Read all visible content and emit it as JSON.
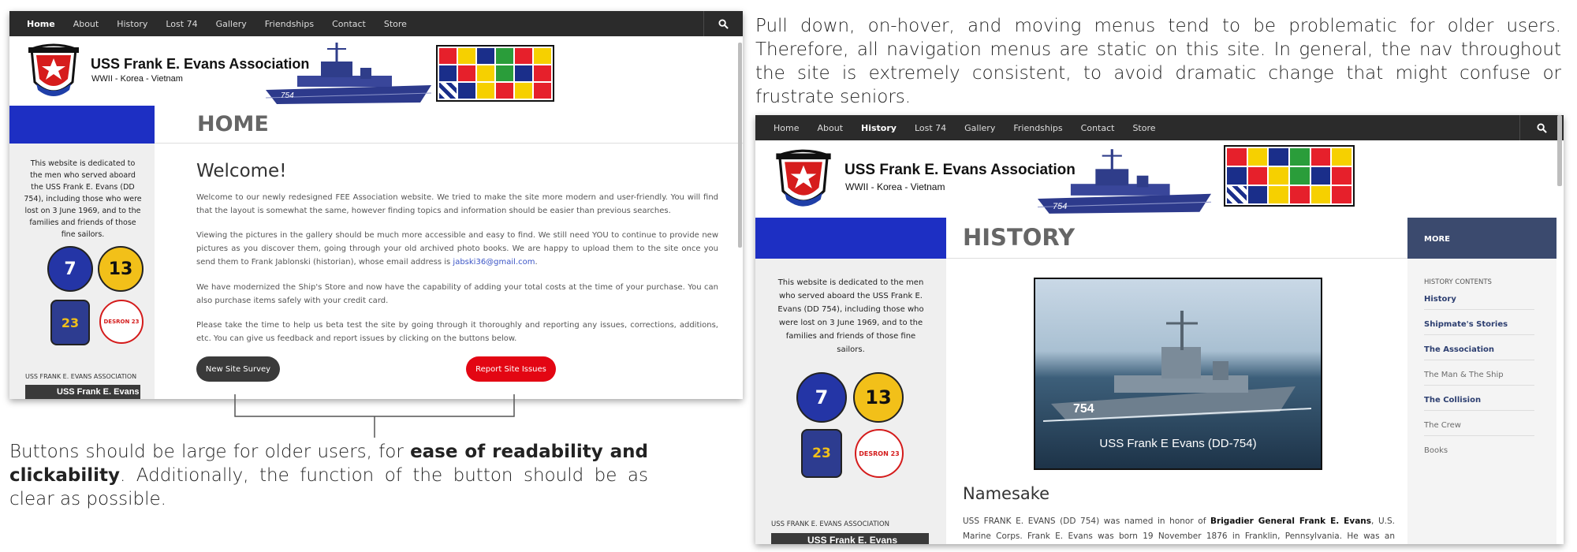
{
  "left_site": {
    "nav": [
      "Home",
      "About",
      "History",
      "Lost 74",
      "Gallery",
      "Friendships",
      "Contact",
      "Store"
    ],
    "active_nav": "Home",
    "site_name": "USS Frank E. Evans Association",
    "site_sub": "WWII - Korea - Vietnam",
    "ship_number": "754",
    "page_title": "HOME",
    "sidebar_text": "This website is dedicated to the men who served aboard the USS Frank E. Evans (DD 754), including those who were lost on 3 June 1969, and to the families and friends of those fine sailors.",
    "badges": [
      "7",
      "13",
      "23",
      "DESRON 23"
    ],
    "assoc_label": "USS FRANK E. EVANS ASSOCIATION",
    "assoc_box": "USS Frank E. Evans",
    "welcome": "Welcome!",
    "paragraphs": [
      "Welcome to our newly redesigned FEE Association website. We tried to make the site more modern and user-friendly. You will find that the layout is somewhat the same, however finding topics and information should be easier than previous searches.",
      "Viewing the pictures in the gallery should be much more accessible and easy to find. We still need YOU to continue to provide new pictures as you discover them, going through your old archived photo books. We are happy to upload them to the site once you send them to Frank Jablonski (historian), whose email address is",
      "We have modernized the Ship's Store and now have the capability of adding your total costs at the time of your purchase. You can also purchase items safely with your credit card.",
      "Please take the time to help us beta test the site by going through it thoroughly and reporting any issues, corrections, additions, etc. You can give us feedback and report issues by clicking on the buttons below."
    ],
    "email": "jabski36@gmail.com",
    "button_survey": "New Site Survey",
    "button_report": "Report Site Issues"
  },
  "right_site": {
    "nav": [
      "Home",
      "About",
      "History",
      "Lost 74",
      "Gallery",
      "Friendships",
      "Contact",
      "Store"
    ],
    "active_nav": "History",
    "site_name": "USS Frank E. Evans Association",
    "site_sub": "WWII - Korea - Vietnam",
    "ship_number": "754",
    "page_title": "HISTORY",
    "sidebar_text": "This website is dedicated to the men who served aboard the USS Frank E. Evans (DD 754), including those who were lost on 3 June 1969, and to the families and friends of those fine sailors.",
    "badges": [
      "7",
      "13",
      "23",
      "DESRON 23"
    ],
    "assoc_label": "USS FRANK E. EVANS ASSOCIATION",
    "assoc_box": "USS Frank E. Evans",
    "photo_caption": "USS Frank E Evans (DD-754)",
    "photo_hull": "754",
    "namesake": "Namesake",
    "namesake_text_a": "USS FRANK E. EVANS (DD 754) was named in honor of ",
    "namesake_bold": "Brigadier General Frank E. Evans",
    "namesake_text_b": ", U.S. Marine Corps. Frank E. Evans was born 19 November 1876 in Franklin, Pennsylvania. He was an infantryman in the",
    "more_title": "MORE",
    "history_contents": "HISTORY CONTENTS",
    "more_links": [
      "History",
      "Shipmate's Stories",
      "The Association",
      "The Man & The Ship",
      "The Collision",
      "The Crew",
      "Books"
    ]
  },
  "captions": {
    "top_right": "Pull down, on-hover, and moving menus tend to be problematic for older users. Therefore, all navigation menus are static on this site. In general, the nav throughout the site is extremely consistent, to avoid dramatic change that might confuse or frustrate seniors.",
    "bottom_left_a": "Buttons should be large for older users, for ",
    "bottom_left_bold": "ease of readability and clickability",
    "bottom_left_b": ". Additionally, the function of the button should be as clear as possible."
  },
  "colors": {
    "nav_bg": "#2b2b2b",
    "blue_bar": "#1d2fc3",
    "report_button": "#e30613",
    "survey_button": "#3a3a3a",
    "more_header": "#3b4a6e"
  }
}
